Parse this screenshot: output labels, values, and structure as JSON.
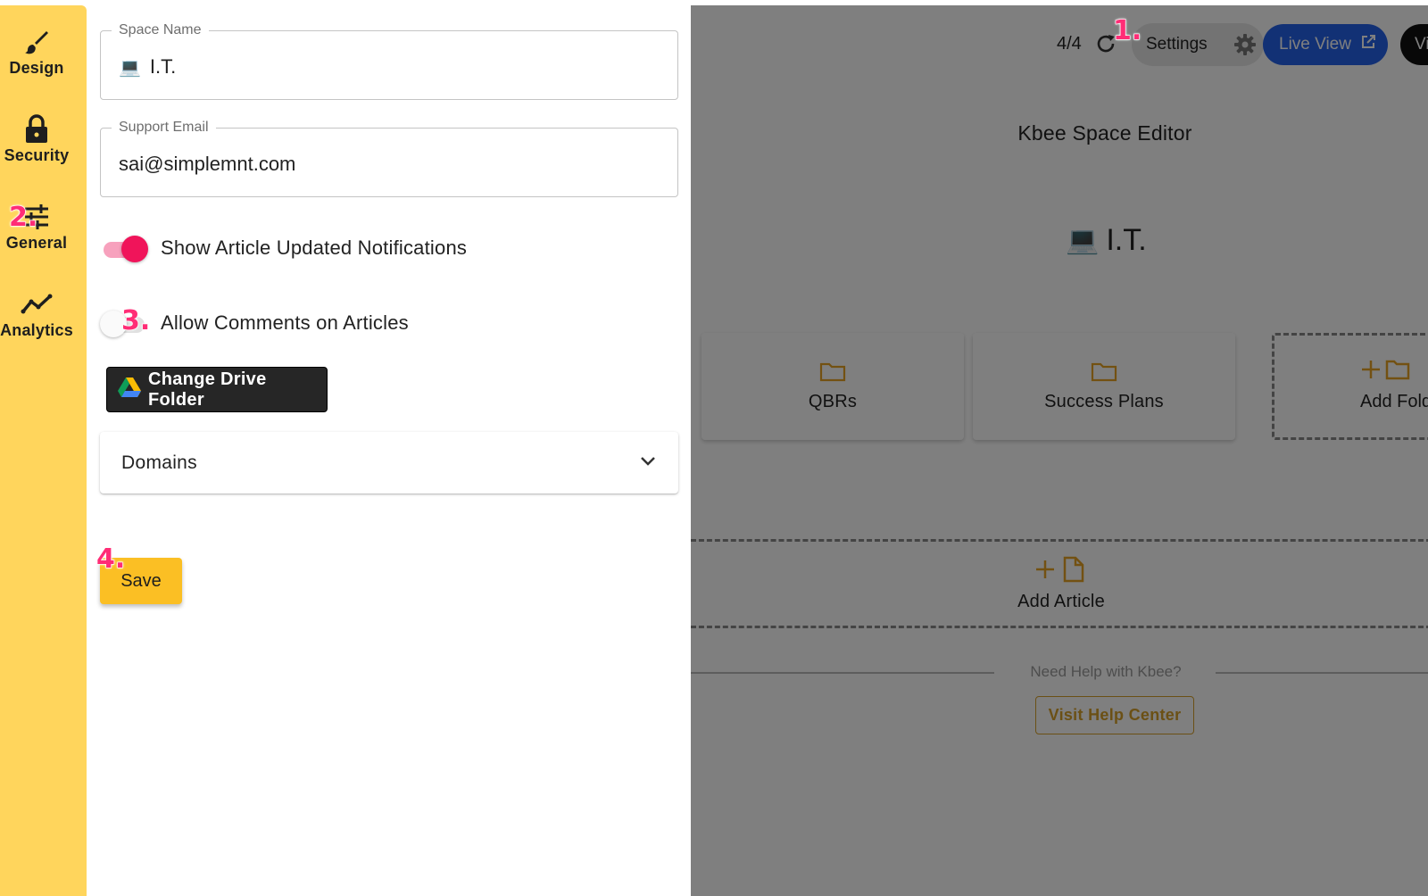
{
  "sidebar": {
    "items": [
      {
        "label": "Design",
        "icon": "brush-icon"
      },
      {
        "label": "Security",
        "icon": "lock-icon"
      },
      {
        "label": "General",
        "icon": "sliders-icon"
      },
      {
        "label": "Analytics",
        "icon": "trend-icon"
      }
    ]
  },
  "form": {
    "space_name": {
      "label": "Space Name",
      "emoji": "💻",
      "value": "I.T."
    },
    "support_email": {
      "label": "Support Email",
      "value": "sai@simplemnt.com"
    },
    "toggles": [
      {
        "label": "Show Article Updated Notifications",
        "on": true
      },
      {
        "label": "Allow Comments on Articles",
        "on": false
      }
    ],
    "drive_button_label": "Change Drive Folder",
    "domains_label": "Domains",
    "save_label": "Save"
  },
  "steps": [
    "1.",
    "2.",
    "3.",
    "4."
  ],
  "preview": {
    "count": "4/4",
    "settings_label": "Settings",
    "live_view_label": "Live View",
    "dark_button_label": "Vi",
    "title": "Kbee Space Editor",
    "space_emoji": "💻",
    "space_name": "I.T.",
    "folders": [
      "QBRs",
      "Success Plans"
    ],
    "add_folder_label": "Add Fold",
    "add_article_label": "Add Article",
    "help_text": "Need Help with Kbee?",
    "help_button_label": "Visit Help Center"
  },
  "colors": {
    "rail": "#ffd55c",
    "accent_pink": "#f0145a",
    "save": "#fbbf24",
    "live_view": "#2563eb",
    "folder": "#e6a325"
  }
}
